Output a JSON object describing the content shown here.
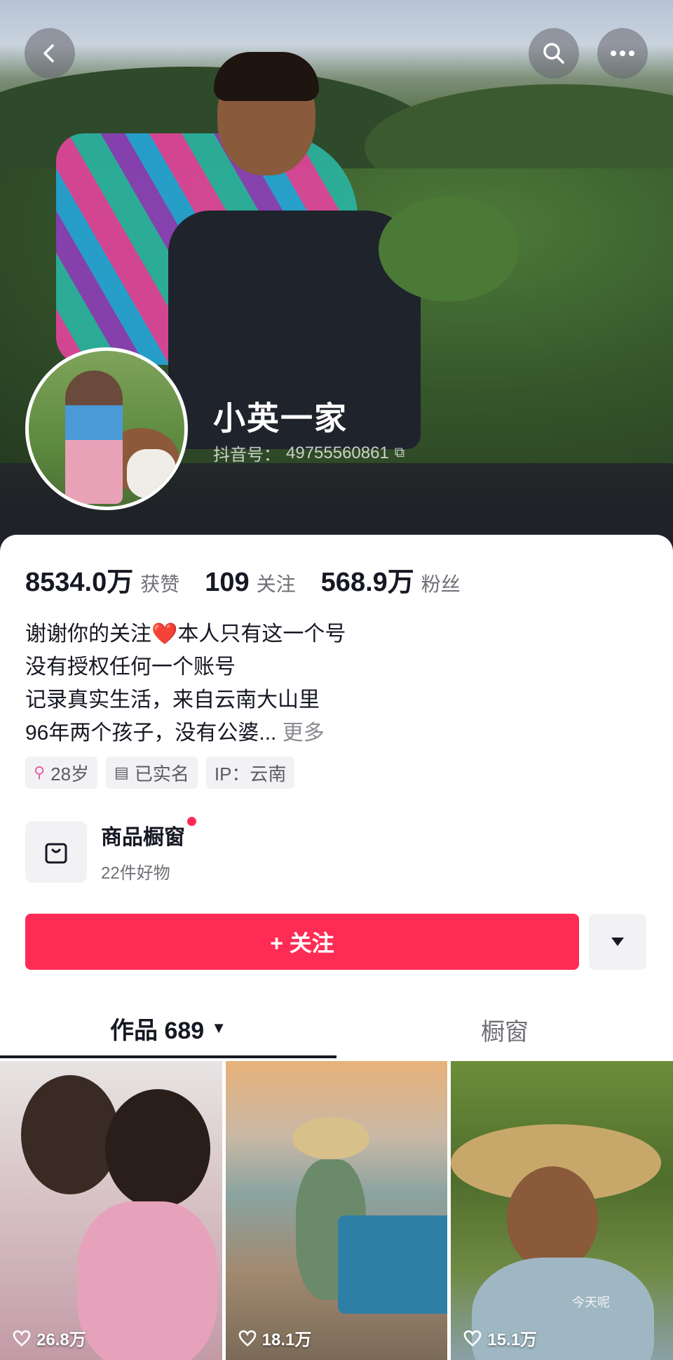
{
  "profile": {
    "name": "小英一家",
    "douyin_id_label": "抖音号：",
    "douyin_id": "49755560861"
  },
  "stats": [
    {
      "value": "8534.0万",
      "label": "获赞"
    },
    {
      "value": "109",
      "label": "关注"
    },
    {
      "value": "568.9万",
      "label": "粉丝"
    }
  ],
  "bio": {
    "line1_before_heart": "谢谢你的关注",
    "heart": "❤️",
    "line1_after_heart": "本人只有这一个号",
    "line2": "没有授权任何一个账号",
    "line3": "记录真实生活，来自云南大山里",
    "line4": "96年两个孩子，没有公婆...",
    "more": "更多"
  },
  "tags": [
    {
      "icon": "female-icon",
      "glyph": "⚲",
      "text": "28岁"
    },
    {
      "icon": "id-card-icon",
      "glyph": "▤",
      "text": "已实名"
    },
    {
      "icon": "",
      "glyph": "",
      "text": "IP：云南"
    }
  ],
  "shop": {
    "title": "商品橱窗",
    "subtitle": "22件好物"
  },
  "follow": {
    "label": "+ 关注"
  },
  "tabs": [
    {
      "label": "作品 689",
      "active": true
    },
    {
      "label": "橱窗",
      "active": false
    }
  ],
  "videos": [
    {
      "likes": "26.8万"
    },
    {
      "likes": "18.1万"
    },
    {
      "likes": "15.1万",
      "caption": "今天呢"
    }
  ],
  "colors": {
    "accent": "#fe2c55",
    "text_primary": "#161823",
    "text_secondary": "#6f7076",
    "chip_bg": "#f2f2f4"
  }
}
